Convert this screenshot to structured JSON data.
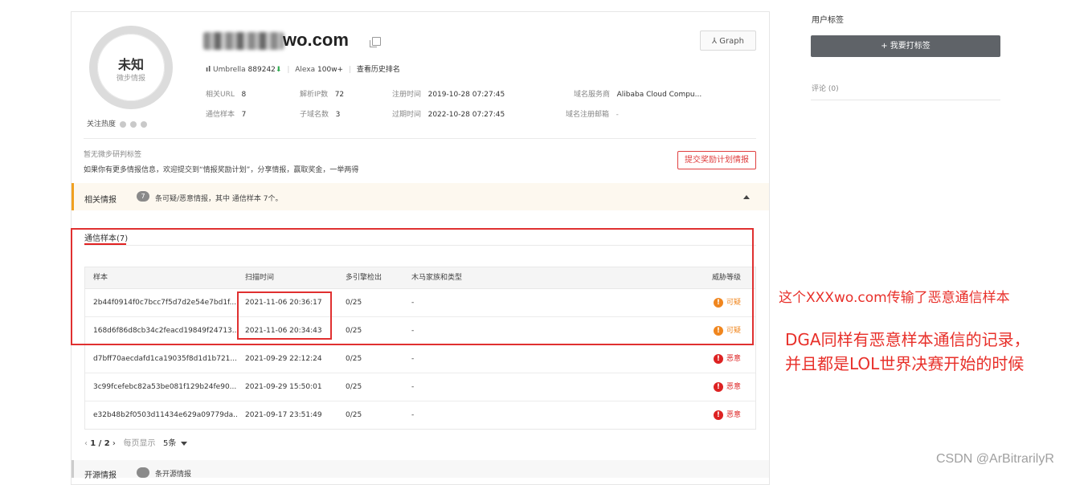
{
  "overview": {
    "risk_label": "未知",
    "risk_sub": "微步情报",
    "heat_label": "关注热度",
    "domain": "wo.com",
    "graph_label": "Graph",
    "umbrella_label": "Umbrella",
    "umbrella_value": "889242",
    "alexa_label": "Alexa",
    "alexa_value": "100w+",
    "history_link": "查看历史排名",
    "meta": [
      {
        "k": "相关URL",
        "v": "8"
      },
      {
        "k": "解析IP数",
        "v": "72"
      },
      {
        "k": "注册时间",
        "v": "2019-10-28 07:27:45"
      },
      {
        "k": "域名服务商",
        "v": "Alibaba Cloud Compu..."
      },
      {
        "k": "通信样本",
        "v": "7"
      },
      {
        "k": "子域名数",
        "v": "3"
      },
      {
        "k": "过期时间",
        "v": "2022-10-28 07:27:45"
      },
      {
        "k": "域名注册邮箱",
        "v": "-"
      }
    ]
  },
  "notes": {
    "no_tag": "暂无微步研判标签",
    "more_info": "如果你有更多情报信息，欢迎提交到“情报奖励计划”，分享情报，赢取奖金，一举两得",
    "reward_button": "提交奖励计划情报"
  },
  "related": {
    "title": "相关情报",
    "count": "7",
    "desc": "条可疑/恶意情报，其中 通信样本 7个。"
  },
  "samples_tab": "通信样本(7)",
  "table": {
    "headers": [
      "样本",
      "扫描时间",
      "多引擎检出",
      "木马家族和类型",
      "威胁等级"
    ],
    "rows": [
      {
        "hash": "2b44f0914f0c7bcc7f5d7d2e54e7bd1f...",
        "time": "2021-11-06 20:36:17",
        "det": "0/25",
        "family": "-",
        "level": "可疑",
        "sev": "orange"
      },
      {
        "hash": "168d6f86d8cb34c2feacd19849f24713...",
        "time": "2021-11-06 20:34:43",
        "det": "0/25",
        "family": "-",
        "level": "可疑",
        "sev": "orange"
      },
      {
        "hash": "d7bff70aecdafd1ca19035f8d1d1b721...",
        "time": "2021-09-29 22:12:24",
        "det": "0/25",
        "family": "-",
        "level": "恶意",
        "sev": "red"
      },
      {
        "hash": "3c99fcefebc82a53be081f129b24fe90...",
        "time": "2021-09-29 15:50:01",
        "det": "0/25",
        "family": "-",
        "level": "恶意",
        "sev": "red"
      },
      {
        "hash": "e32b48b2f0503d11434e629a09779da...",
        "time": "2021-09-17 23:51:49",
        "det": "0/25",
        "family": "-",
        "level": "恶意",
        "sev": "red"
      }
    ]
  },
  "pager": {
    "page": "1 / 2",
    "per_page_label": "每页显示",
    "per_page_value": "5条"
  },
  "bottom": {
    "title": "开源情报",
    "desc": "条开源情报"
  },
  "sidebar": {
    "user_tags": "用户标签",
    "tag_button": "+ 我要打标签",
    "comments": "评论 (0)"
  },
  "annotations": {
    "a1": "这个XXXwo.com传输了恶意通信样本",
    "a2_line1": "DGA同样有恶意样本通信的记录，",
    "a2_line2": "并且都是LOL世界决赛开始的时候"
  },
  "watermark": "CSDN @ArBitrarilyR",
  "colors": {
    "accent_red": "#e03030",
    "suspicious": "#f0861e",
    "malicious": "#dd2222",
    "intel_border": "#f0a020"
  }
}
